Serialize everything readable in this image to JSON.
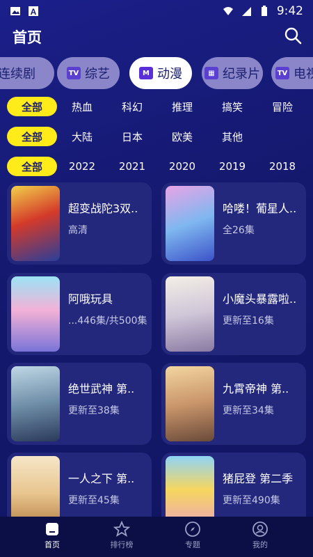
{
  "status": {
    "time": "9:42"
  },
  "header": {
    "title": "首页"
  },
  "tabs": [
    {
      "label": "连续剧",
      "icon": "",
      "active": false
    },
    {
      "label": "综艺",
      "icon": "TV",
      "active": false
    },
    {
      "label": "动漫",
      "icon": "M",
      "active": true
    },
    {
      "label": "纪录片",
      "icon": "film",
      "active": false
    },
    {
      "label": "电视",
      "icon": "TV",
      "active": false
    }
  ],
  "filters": {
    "genre": [
      "全部",
      "热血",
      "科幻",
      "推理",
      "搞笑",
      "冒险"
    ],
    "region": [
      "全部",
      "大陆",
      "日本",
      "欧美",
      "其他"
    ],
    "year": [
      "全部",
      "2022",
      "2021",
      "2020",
      "2019",
      "2018"
    ]
  },
  "cards": [
    {
      "name": "超变战陀3双..",
      "sub": "高清"
    },
    {
      "name": "哈喽！葡星人..",
      "sub": "全26集"
    },
    {
      "name": "阿哦玩具",
      "sub": "...446集/共500集"
    },
    {
      "name": "小魔头暴露啦..",
      "sub": "更新至16集"
    },
    {
      "name": "绝世武神 第..",
      "sub": "更新至38集"
    },
    {
      "name": "九霄帝神 第..",
      "sub": "更新至34集"
    },
    {
      "name": "一人之下 第..",
      "sub": "更新至45集"
    },
    {
      "name": "猪屁登 第二季",
      "sub": "更新至490集"
    }
  ],
  "nav": [
    {
      "label": "首页",
      "icon": "home-icon",
      "active": true
    },
    {
      "label": "排行榜",
      "icon": "star-icon",
      "active": false
    },
    {
      "label": "专题",
      "icon": "compass-icon",
      "active": false
    },
    {
      "label": "我的",
      "icon": "profile-icon",
      "active": false
    }
  ],
  "colors": {
    "bg": "#15196f",
    "accent": "#ffeb1a",
    "tab": "#8a86c9",
    "card": "#23287d"
  }
}
